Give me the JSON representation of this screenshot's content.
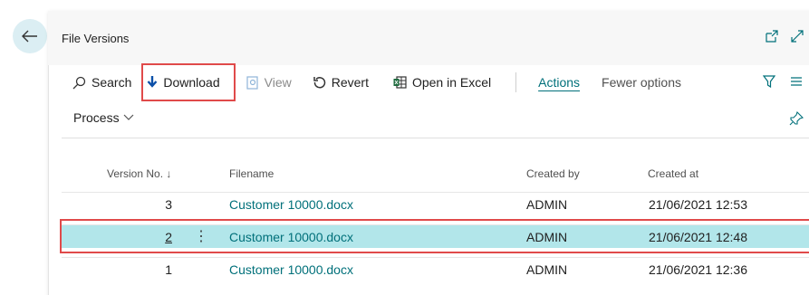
{
  "page": {
    "title": "File Versions"
  },
  "toolbar": {
    "search_label": "Search",
    "download_label": "Download",
    "view_label": "View",
    "revert_label": "Revert",
    "open_excel_label": "Open in Excel",
    "actions_label": "Actions",
    "fewer_options_label": "Fewer options"
  },
  "process": {
    "label": "Process"
  },
  "table": {
    "columns": [
      "Version No. ↓",
      "Filename",
      "Created by",
      "Created at"
    ],
    "rows": [
      {
        "version": "3",
        "filename": "Customer 10000.docx",
        "created_by": "ADMIN",
        "created_at": "21/06/2021 12:53"
      },
      {
        "version": "2",
        "filename": "Customer 10000.docx",
        "created_by": "ADMIN",
        "created_at": "21/06/2021 12:48"
      },
      {
        "version": "1",
        "filename": "Customer 10000.docx",
        "created_by": "ADMIN",
        "created_at": "21/06/2021 12:36"
      }
    ]
  },
  "icons": {
    "back": "arrow-left-icon",
    "open_new": "open-new-window-icon",
    "expand": "expand-icon",
    "search": "search-icon",
    "download": "download-arrow-icon",
    "view": "view-icon",
    "revert": "revert-icon",
    "excel": "excel-icon",
    "filter": "filter-icon",
    "list": "list-icon",
    "pin": "pin-icon",
    "chevron": "chevron-down-icon"
  },
  "colors": {
    "accent": "#00707a",
    "selected_row": "#b2e6ea",
    "highlight": "#e04a4a"
  }
}
